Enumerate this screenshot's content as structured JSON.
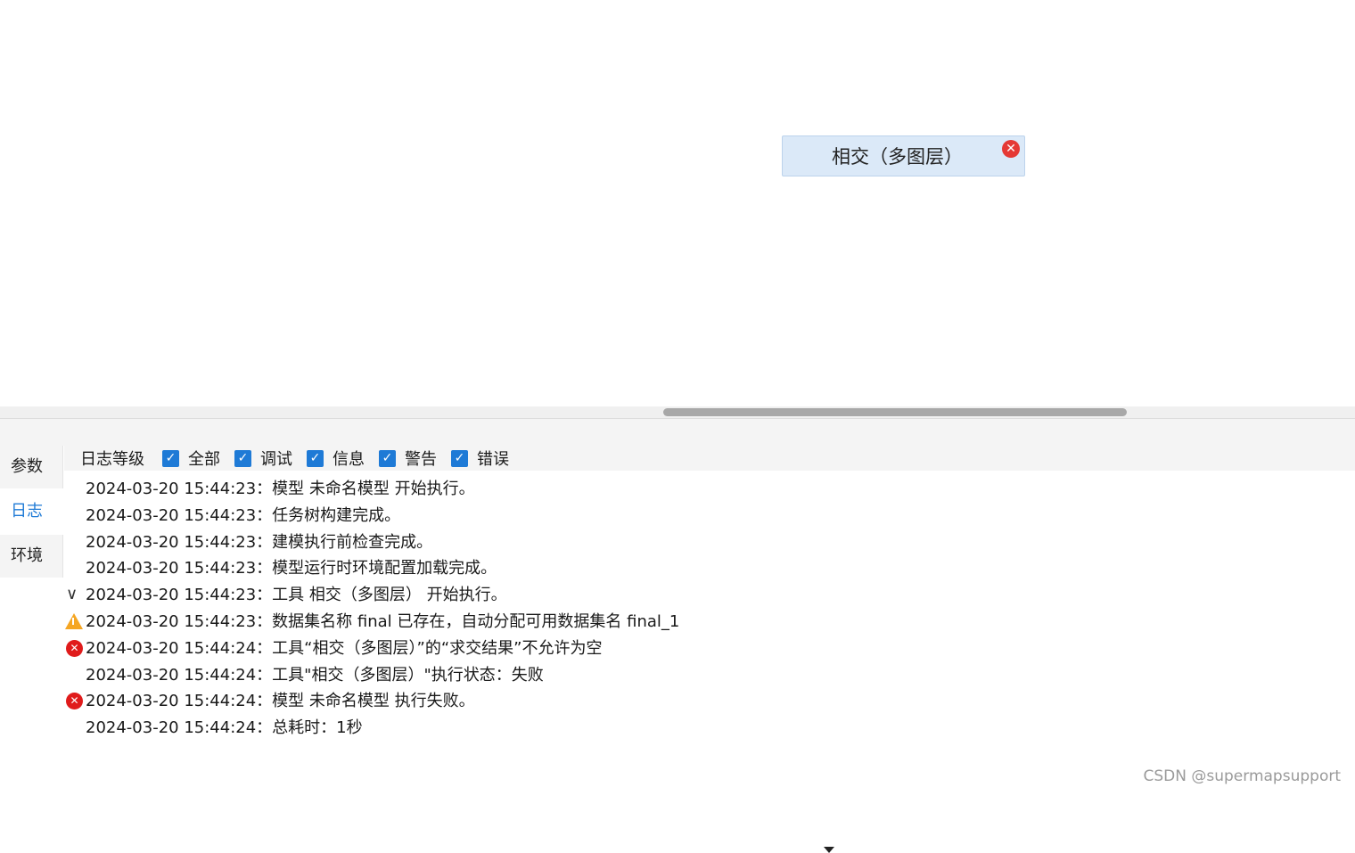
{
  "canvas": {
    "node": {
      "label": "相交（多图层）",
      "close_icon": "close-icon"
    }
  },
  "panel": {
    "side_tabs": [
      {
        "label": "参数",
        "active": false
      },
      {
        "label": "日志",
        "active": true
      },
      {
        "label": "环境",
        "active": false
      }
    ],
    "filter": {
      "title": "日志等级",
      "items": [
        {
          "label": "全部",
          "checked": true
        },
        {
          "label": "调试",
          "checked": true
        },
        {
          "label": "信息",
          "checked": true
        },
        {
          "label": "警告",
          "checked": true
        },
        {
          "label": "错误",
          "checked": true
        }
      ]
    },
    "logs": [
      {
        "icon": "",
        "text": "2024-03-20 15:44:23：模型 未命名模型 开始执行。"
      },
      {
        "icon": "",
        "text": "2024-03-20 15:44:23：任务树构建完成。"
      },
      {
        "icon": "",
        "text": "2024-03-20 15:44:23：建模执行前检查完成。"
      },
      {
        "icon": "",
        "text": "2024-03-20 15:44:23：模型运行时环境配置加载完成。"
      },
      {
        "icon": "chevron-down-icon",
        "text": "2024-03-20 15:44:23：工具 相交（多图层） 开始执行。"
      },
      {
        "icon": "warning-icon",
        "text": "2024-03-20 15:44:23：数据集名称 final 已存在，自动分配可用数据集名 final_1"
      },
      {
        "icon": "error-icon",
        "text": "2024-03-20 15:44:24：工具“相交（多图层）”的“求交结果”不允许为空"
      },
      {
        "icon": "",
        "text": "2024-03-20 15:44:24：工具\"相交（多图层）\"执行状态：失败"
      },
      {
        "icon": "error-icon",
        "text": "2024-03-20 15:44:24：模型 未命名模型 执行失败。"
      },
      {
        "icon": "",
        "text": "2024-03-20 15:44:24：总耗时：1秒"
      }
    ]
  },
  "watermark": "CSDN @supermapsupport",
  "colors": {
    "accent": "#1e7ad6",
    "error": "#e01b1b",
    "warning": "#f5a623",
    "node_bg": "#dbe9f8"
  }
}
